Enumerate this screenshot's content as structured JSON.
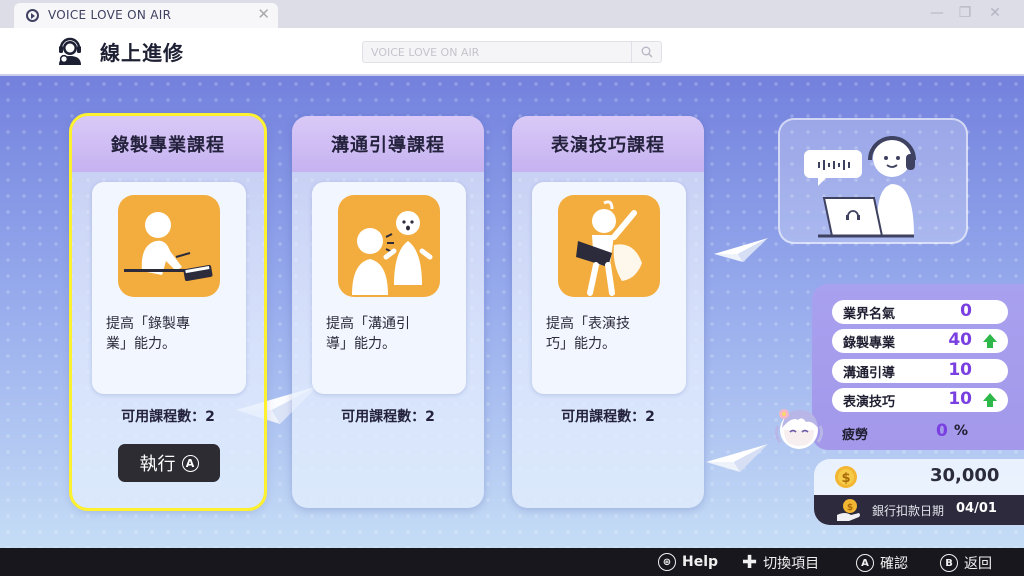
{
  "window": {
    "tab_title": "VOICE LOVE ON AIR",
    "close_glyph": "✕",
    "minimize_glyph": "—",
    "maximize_glyph": "❐",
    "close_window_glyph": "✕"
  },
  "header": {
    "title": "線上進修",
    "search_placeholder": "VOICE LOVE ON AIR",
    "icon": "headset-person-icon"
  },
  "courses": [
    {
      "title": "錄製專業課程",
      "desc_line1": "提高「錄製專",
      "desc_line2": "業」能力。",
      "count_label": "可用課程數：2",
      "selected": true
    },
    {
      "title": "溝通引導課程",
      "desc_line1": "提高「溝通引",
      "desc_line2": "導」能力。",
      "count_label": "可用課程數：2",
      "selected": false
    },
    {
      "title": "表演技巧課程",
      "desc_line1": "提高「表演技",
      "desc_line2": "巧」能力。",
      "count_label": "可用課程數：2",
      "selected": false
    }
  ],
  "execute": {
    "label": "執行",
    "glyph": "A"
  },
  "stats": [
    {
      "label": "業界名氣",
      "value": "0",
      "up": false
    },
    {
      "label": "錄製專業",
      "value": "40",
      "up": true
    },
    {
      "label": "溝通引導",
      "value": "10",
      "up": false
    },
    {
      "label": "表演技巧",
      "value": "10",
      "up": true
    }
  ],
  "fatigue": {
    "label": "疲勞",
    "value": "0",
    "unit": "%"
  },
  "money": {
    "value": "30,000"
  },
  "bank": {
    "label": "銀行扣款日期",
    "date": "04/01"
  },
  "footer": {
    "help": {
      "glyph": "⊛",
      "label": "Help"
    },
    "switch": {
      "glyph": "✚",
      "label": "切換項目"
    },
    "confirm": {
      "glyph": "A",
      "label": "確認"
    },
    "back": {
      "glyph": "B",
      "label": "返回"
    }
  },
  "colors": {
    "accent_purple": "#7a3fe0",
    "up_arrow_green": "#2fb84a",
    "selection_yellow": "#fff130",
    "course_icon_orange": "#f3ad3f"
  }
}
